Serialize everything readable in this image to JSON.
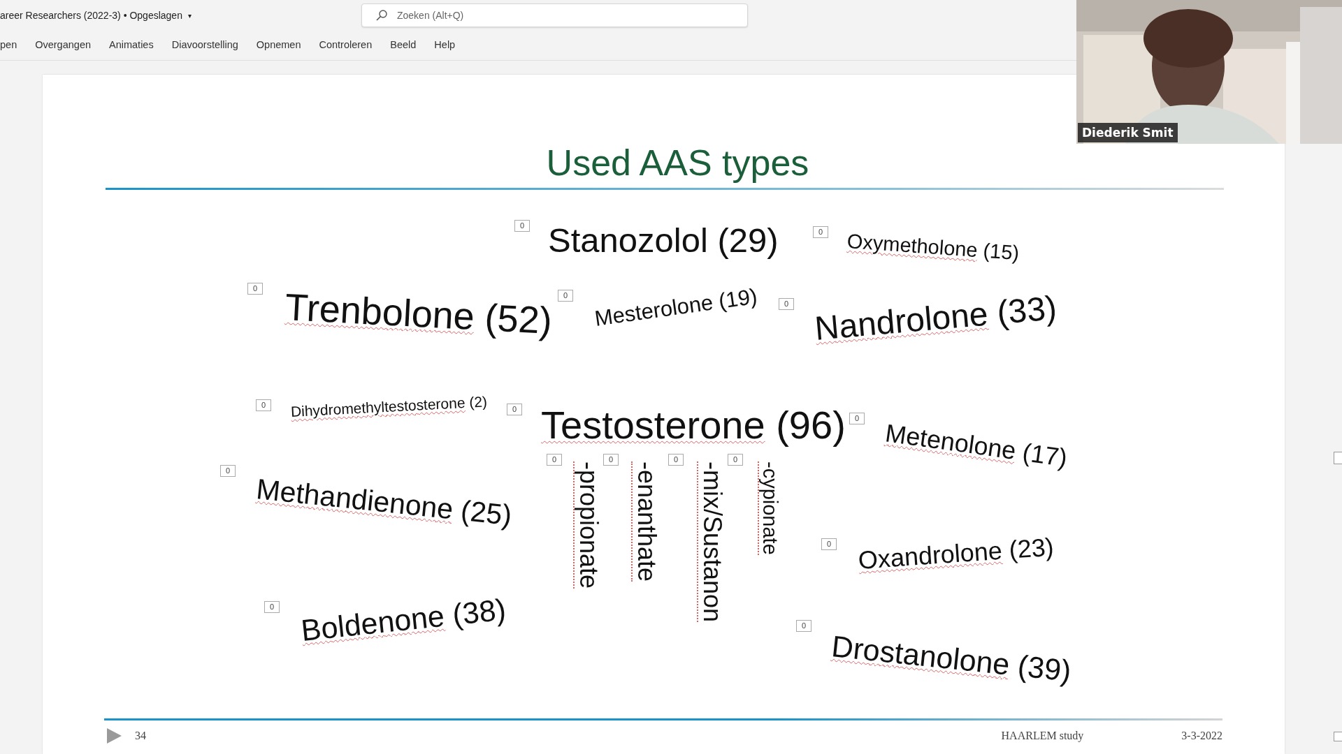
{
  "document": {
    "title": "areer Researchers (2022-3) • Opgeslagen",
    "caret": "▾"
  },
  "search": {
    "placeholder": "Zoeken (Alt+Q)"
  },
  "ribbon_tabs": [
    "pen",
    "Overgangen",
    "Animaties",
    "Diavoorstelling",
    "Opnemen",
    "Controleren",
    "Beeld",
    "Help"
  ],
  "video": {
    "kind": "picture",
    "participant": "Diederik Smit"
  },
  "slide": {
    "title": "Used AAS types",
    "words": [
      {
        "kind": "horizontal",
        "name": "Stanozolol",
        "count": "(29)",
        "spellcheck": false
      },
      {
        "kind": "horizontal",
        "name": "Oxymetholone",
        "count": "(15)",
        "spellcheck": true
      },
      {
        "kind": "horizontal",
        "name": "Trenbolone",
        "count": "(52)",
        "spellcheck": true
      },
      {
        "kind": "horizontal",
        "name": "Mesterolone",
        "count": "(19)",
        "spellcheck": false
      },
      {
        "kind": "horizontal",
        "name": "Nandrolone",
        "count": "(33)",
        "spellcheck": true
      },
      {
        "kind": "horizontal",
        "name": "Dihydromethyltestosterone",
        "count": "(2)",
        "spellcheck": true
      },
      {
        "kind": "horizontal",
        "name": "Testosterone",
        "count": "(96)",
        "spellcheck": true
      },
      {
        "kind": "horizontal",
        "name": "Metenolone",
        "count": "(17)",
        "spellcheck": true
      },
      {
        "kind": "horizontal",
        "name": "Methandienone",
        "count": "(25)",
        "spellcheck": true
      },
      {
        "kind": "vertical",
        "name": "-propionate",
        "spellcheck": true
      },
      {
        "kind": "vertical",
        "name": "-enanthate",
        "spellcheck": true
      },
      {
        "kind": "vertical",
        "name": "-mix/Sustanon",
        "spellcheck": true
      },
      {
        "kind": "vertical",
        "name": "-cypionate",
        "spellcheck": true
      },
      {
        "kind": "horizontal",
        "name": "Oxandrolone",
        "count": "(23)",
        "spellcheck": true
      },
      {
        "kind": "horizontal",
        "name": "Boldenone",
        "count": "(38)",
        "spellcheck": true
      },
      {
        "kind": "horizontal",
        "name": "Drostanolone",
        "count": "(39)",
        "spellcheck": true
      }
    ],
    "counters": [
      "0",
      "0",
      "0",
      "0",
      "0",
      "0",
      "0",
      "0",
      "0",
      "0",
      "0",
      "0",
      "0",
      "0",
      "0",
      "0"
    ],
    "number": "34",
    "footer": "HAARLEM study",
    "date": "3-3-2022"
  }
}
